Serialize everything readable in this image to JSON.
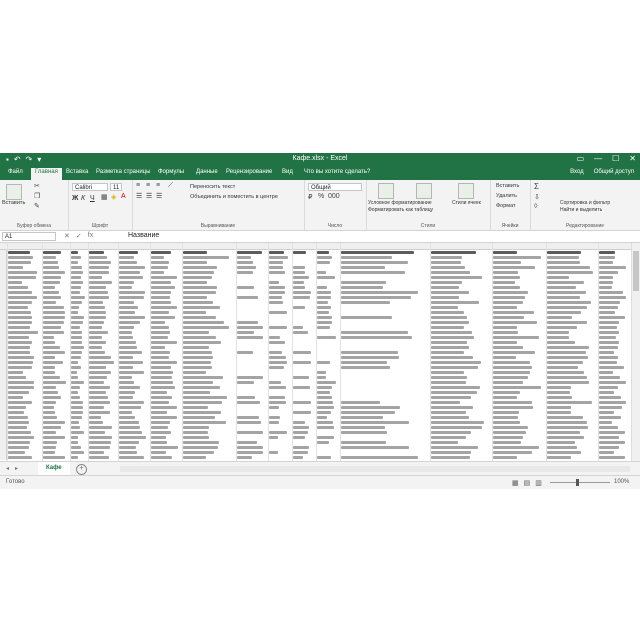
{
  "window": {
    "title": "Кафе.xlsx - Excel",
    "qat": [
      "↶",
      "↷",
      "▾"
    ],
    "controls": [
      "▭",
      "—",
      "☐",
      "✕"
    ]
  },
  "tabs": [
    "Файл",
    "Главная",
    "Вставка",
    "Разметка страницы",
    "Формулы",
    "Данные",
    "Рецензирование",
    "Вид",
    "Что вы хотите сделать?"
  ],
  "tabs_right": [
    "Вход",
    "Общий доступ"
  ],
  "ribbon": {
    "clipboard": {
      "paste": "Вставить",
      "label": "Буфер обмена"
    },
    "font": {
      "name": "Calibri",
      "size": "11",
      "bold": "Ж",
      "italic": "К",
      "underline": "Ч",
      "label": "Шрифт"
    },
    "alignment": {
      "wrap": "Переносить текст",
      "merge": "Объединить и поместить в центре",
      "label": "Выравнивание"
    },
    "number": {
      "format": "Общий",
      "label": "Число"
    },
    "styles": {
      "conditional": "Условное форматирование",
      "table": "Форматировать как таблицу",
      "cell": "Стили ячеек",
      "label": "Стили"
    },
    "cells": {
      "insert": "Вставить",
      "delete": "Удалить",
      "format": "Формат",
      "label": "Ячейки"
    },
    "editing": {
      "sort": "Сортировка и фильтр",
      "find": "Найти и выделить",
      "label": "Редактирование"
    }
  },
  "formula_bar": {
    "name_box": "A1",
    "icons": [
      "✕",
      "✓",
      "fx"
    ],
    "value": "Название"
  },
  "sheet_tabs": {
    "active": "Кафе",
    "add": "+",
    "nav": [
      "◂",
      "▸"
    ]
  },
  "status": {
    "ready": "Готово",
    "zoom": "100%",
    "views": [
      "▦",
      "▤",
      "▥"
    ]
  },
  "colors": {
    "excel_green": "#217346"
  }
}
